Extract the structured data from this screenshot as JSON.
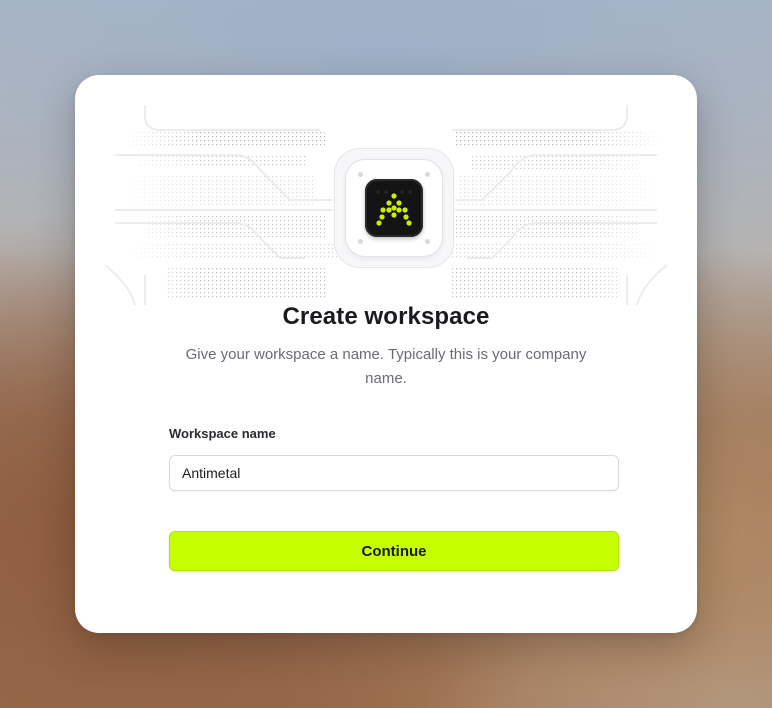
{
  "modal": {
    "title": "Create workspace",
    "subtitle": "Give your workspace a name. Typically this is your company name.",
    "logo_icon": "antimetal-dot-matrix-logo-icon",
    "accent_color": "#c6ff00",
    "logo_dot_color": "#c8f000"
  },
  "form": {
    "workspace_name_label": "Workspace name",
    "workspace_name_value": "Antimetal",
    "workspace_name_placeholder": ""
  },
  "actions": {
    "continue_label": "Continue"
  }
}
